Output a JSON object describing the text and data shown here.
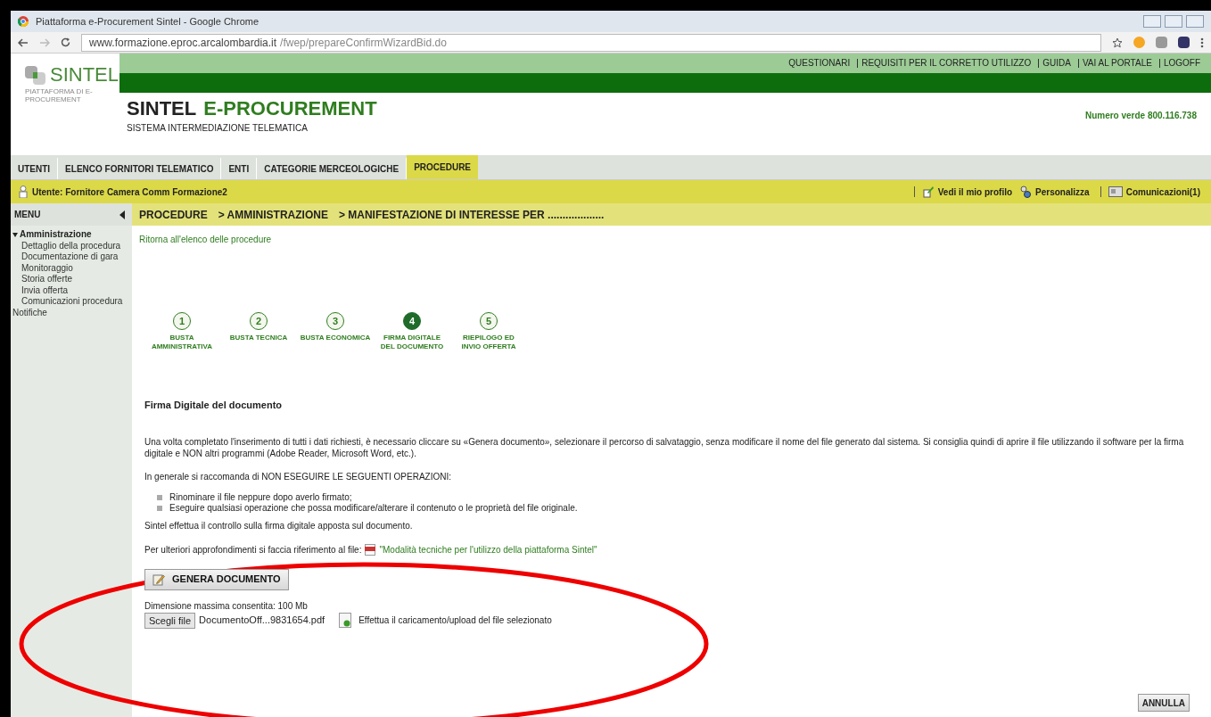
{
  "window": {
    "title": "Piattaforma e-Procurement Sintel - Google Chrome"
  },
  "address_bar": {
    "host": "www.formazione.eproc.arcalombardia.it",
    "path": "/fwep/prepareConfirmWizardBid.do"
  },
  "header": {
    "logo": "SINTEL",
    "logo_tagline": "PIATTAFORMA DI E-PROCUREMENT",
    "title_part_1": "SINTEL",
    "title_part_2": "E-PROCUREMENT",
    "subtitle": "SISTEMA INTERMEDIAZIONE TELEMATICA",
    "phone": "Numero verde 800.116.738",
    "top_links": [
      "QUESTIONARI",
      "REQUISITI PER IL CORRETTO UTILIZZO",
      "GUIDA",
      "VAI AL PORTALE",
      "LOGOFF"
    ]
  },
  "tabs": [
    {
      "label": "UTENTI",
      "selected": false
    },
    {
      "label": "ELENCO FORNITORI TELEMATICO",
      "selected": false
    },
    {
      "label": "ENTI",
      "selected": false
    },
    {
      "label": "CATEGORIE MERCEOLOGICHE",
      "selected": false
    },
    {
      "label": "PROCEDURE",
      "selected": true
    }
  ],
  "user_bar": {
    "user": "Utente: Fornitore Camera Comm Formazione2",
    "links": [
      {
        "kind": "profile",
        "label": "Vedi il mio profilo"
      },
      {
        "kind": "customize",
        "label": "Personalizza"
      },
      {
        "kind": "messages",
        "label": "Comunicazioni(1)"
      }
    ]
  },
  "sidebar": {
    "title": "MENU",
    "items": [
      {
        "label": "Amministrazione",
        "expanded": true,
        "children": [
          {
            "label": "Dettaglio della procedura"
          },
          {
            "label": "Documentazione di gara"
          },
          {
            "label": "Monitoraggio"
          },
          {
            "label": "Storia offerte"
          },
          {
            "label": "Invia offerta"
          },
          {
            "label": "Comunicazioni procedura"
          }
        ]
      },
      {
        "label": "Notifiche"
      }
    ]
  },
  "breadcrumb": [
    "PROCEDURE",
    "> AMMINISTRAZIONE",
    "> MANIFESTAZIONE DI INTERESSE PER ..................."
  ],
  "back_link": "Ritorna all'elenco delle procedure",
  "steps": [
    {
      "number": "1",
      "label": "BUSTA AMMINISTRATIVA",
      "selected": false
    },
    {
      "number": "2",
      "label": "BUSTA TECNICA",
      "selected": false
    },
    {
      "number": "3",
      "label": "BUSTA ECONOMICA",
      "selected": false
    },
    {
      "number": "4",
      "label": "FIRMA DIGITALE DEL DOCUMENTO",
      "selected": true
    },
    {
      "number": "5",
      "label": "RIEPILOGO ED INVIO OFFERTA",
      "selected": false
    }
  ],
  "section": {
    "heading": "Firma Digitale del documento",
    "intro": "Una volta completato l'inserimento di tutti i dati richiesti, è necessario cliccare su «Genera documento», selezionare il percorso di salvataggio, senza modificare il nome del file generato dal sistema. Si consiglia quindi di aprire il file utilizzando il software per la firma digitale e NON altri programmi (Adobe Reader, Microsoft Word, etc.).",
    "warning": "In generale si raccomanda di NON ESEGUIRE LE SEGUENTI OPERAZIONI:",
    "bullets": [
      "Rinominare il file neppure dopo averlo firmato;",
      "Eseguire qualsiasi operazione che possa modificare/alterare il contenuto o le proprietà del file originale."
    ],
    "check_note": "Sintel effettua il controllo sulla firma digitale apposta sul documento.",
    "reference_text": "Per ulteriori approfondimenti si faccia riferimento al file:",
    "reference_link": "\"Modalità tecniche per l'utilizzo della piattaforma Sintel\"",
    "generate_button": "GENERA DOCUMENTO",
    "max_size": "Dimensione massima consentita: 100 Mb",
    "file_button": "Scegli file",
    "file_name": "DocumentoOff...9831654.pdf",
    "upload_label": "Effettua il caricamento/upload del file selezionato"
  },
  "cancel_button": "ANNULLA",
  "annotation": {
    "kind": "ellipse"
  }
}
